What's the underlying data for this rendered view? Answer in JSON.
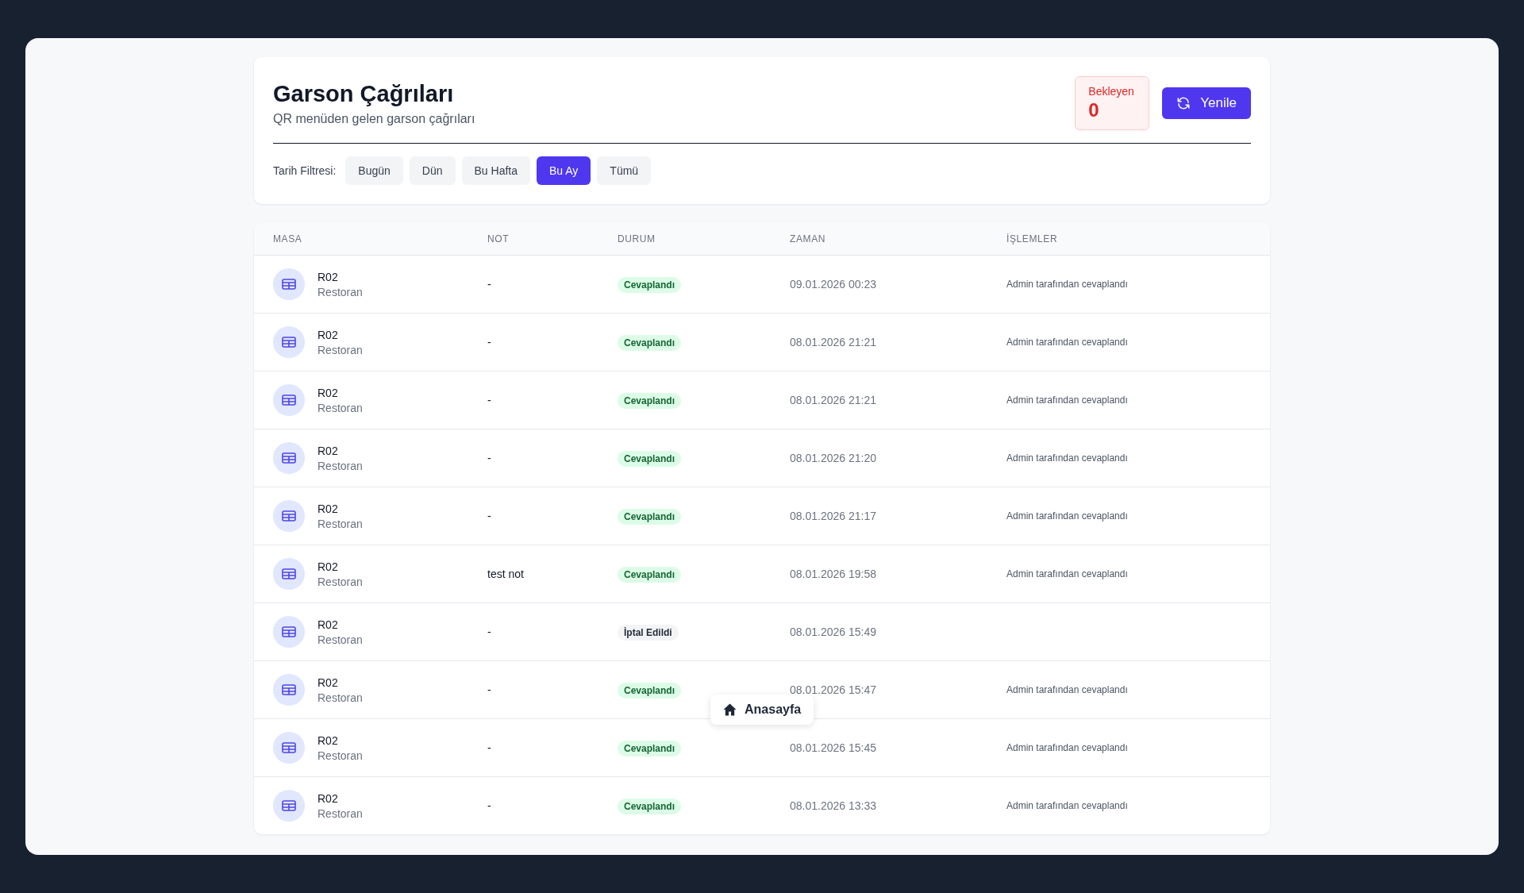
{
  "header": {
    "title": "Garson Çağrıları",
    "subtitle": "QR menüden gelen garson çağrıları",
    "pending": {
      "label": "Bekleyen",
      "count": "0"
    },
    "refresh_button": "Yenile"
  },
  "filter": {
    "label": "Tarih Filtresi:",
    "options": [
      {
        "label": "Bugün",
        "selected": false
      },
      {
        "label": "Dün",
        "selected": false
      },
      {
        "label": "Bu Hafta",
        "selected": false
      },
      {
        "label": "Bu Ay",
        "selected": true
      },
      {
        "label": "Tümü",
        "selected": false
      }
    ]
  },
  "table": {
    "columns": [
      "MASA",
      "NOT",
      "DURUM",
      "ZAMAN",
      "İŞLEMLER"
    ],
    "rows": [
      {
        "table": "R02",
        "area": "Restoran",
        "note": "-",
        "status": {
          "kind": "answered",
          "label": "Cevaplandı"
        },
        "time": "09.01.2026 00:23",
        "action": "Admin tarafından cevaplandı"
      },
      {
        "table": "R02",
        "area": "Restoran",
        "note": "-",
        "status": {
          "kind": "answered",
          "label": "Cevaplandı"
        },
        "time": "08.01.2026 21:21",
        "action": "Admin tarafından cevaplandı"
      },
      {
        "table": "R02",
        "area": "Restoran",
        "note": "-",
        "status": {
          "kind": "answered",
          "label": "Cevaplandı"
        },
        "time": "08.01.2026 21:21",
        "action": "Admin tarafından cevaplandı"
      },
      {
        "table": "R02",
        "area": "Restoran",
        "note": "-",
        "status": {
          "kind": "answered",
          "label": "Cevaplandı"
        },
        "time": "08.01.2026 21:20",
        "action": "Admin tarafından cevaplandı"
      },
      {
        "table": "R02",
        "area": "Restoran",
        "note": "-",
        "status": {
          "kind": "answered",
          "label": "Cevaplandı"
        },
        "time": "08.01.2026 21:17",
        "action": "Admin tarafından cevaplandı"
      },
      {
        "table": "R02",
        "area": "Restoran",
        "note": "test not",
        "status": {
          "kind": "answered",
          "label": "Cevaplandı"
        },
        "time": "08.01.2026 19:58",
        "action": "Admin tarafından cevaplandı"
      },
      {
        "table": "R02",
        "area": "Restoran",
        "note": "-",
        "status": {
          "kind": "cancelled",
          "label": "İptal Edildi"
        },
        "time": "08.01.2026 15:49"
      },
      {
        "table": "R02",
        "area": "Restoran",
        "note": "-",
        "status": {
          "kind": "answered",
          "label": "Cevaplandı"
        },
        "time": "08.01.2026 15:47",
        "action": "Admin tarafından cevaplandı"
      },
      {
        "table": "R02",
        "area": "Restoran",
        "note": "-",
        "status": {
          "kind": "answered",
          "label": "Cevaplandı"
        },
        "time": "08.01.2026 15:45",
        "action": "Admin tarafından cevaplandı"
      },
      {
        "table": "R02",
        "area": "Restoran",
        "note": "-",
        "status": {
          "kind": "answered",
          "label": "Cevaplandı"
        },
        "time": "08.01.2026 13:33",
        "action": "Admin tarafından cevaplandı"
      }
    ]
  },
  "home_button": "Anasayfa"
}
